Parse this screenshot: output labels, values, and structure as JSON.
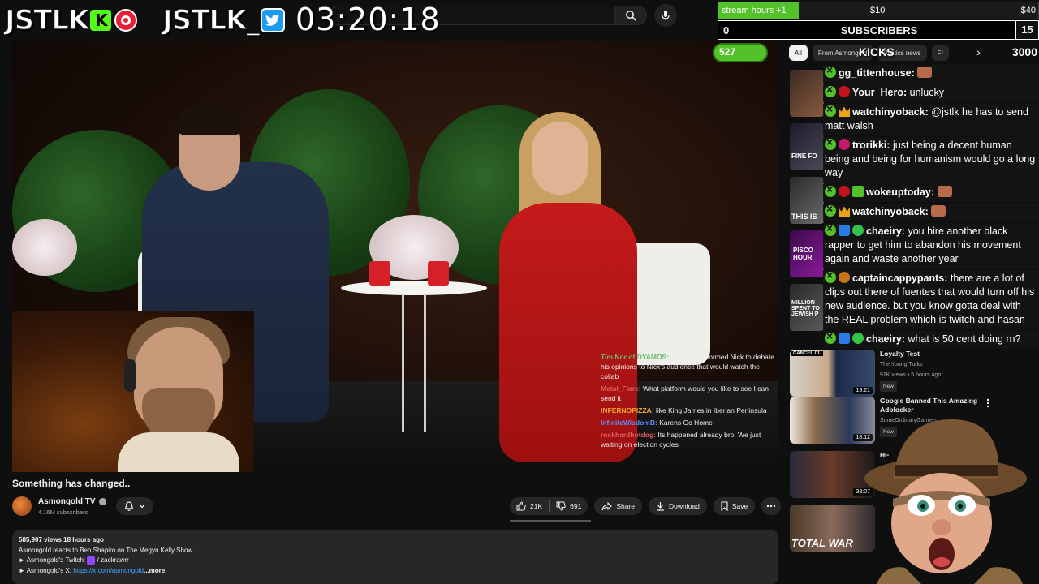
{
  "header": {
    "search_placeholder": "",
    "logo_left_text": "JSTLK",
    "logo_left_badge": "K",
    "logo_right_text": "JSTLK_",
    "clock": "03:20:18"
  },
  "overlay": {
    "stream_hours_label": "stream hours +1",
    "stream_hours_fill": 0.25,
    "stream_mid_amount": "$10",
    "stream_right_amount": "$40",
    "subs_left": "0",
    "subs_label": "SUBSCRIBERS",
    "subs_right": "15",
    "kicks_value": "527",
    "kicks_label": "KICKS",
    "kicks_goal": "3000"
  },
  "chips": [
    "All",
    "From Asmongold",
    "Politics news",
    "Fr"
  ],
  "video": {
    "embedded_chat": [
      {
        "name": "Tim Nor of DYAMOS:",
        "text": "Destiny platformed Nick to debate his opinions to Nick's audience that would watch the collab",
        "color": "n-g"
      },
      {
        "name": "Metal_Flare:",
        "text": "What platform would you like to see I can send it",
        "color": "n-r"
      },
      {
        "name": "INFERNOPIZZA:",
        "text": "like King James in Iberian Peninsula",
        "color": "n-o"
      },
      {
        "name": "InfiniteWisdomB:",
        "text": "Karens Go Home",
        "color": "n-b"
      },
      {
        "name": "rockhardhotdog:",
        "text": "Its happened already bro. We just waiting on election cycles",
        "color": "n-r"
      }
    ],
    "title": "Something has changed.."
  },
  "channel": {
    "name": "Asmongold TV",
    "subscribers": "4.16M subscribers"
  },
  "actions": {
    "likes": "21K",
    "dislikes": "691",
    "share": "Share",
    "download": "Download",
    "save": "Save"
  },
  "description": {
    "meta": "585,907 views  18 hours ago",
    "line1": "Asmongold reacts to Ben Shapiro on The Megyn Kelly Show.",
    "line2_prefix": "► Asmongold's Twitch: ",
    "line2_link": " / zackrawrr",
    "line3_prefix": "► Asmongold's X: ",
    "line3_link": "https://x.com/asmongold",
    "more": "...more"
  },
  "recommendations": [
    {
      "title": "Loyalty Test",
      "channel": "The Young Turks",
      "meta": "91K views • 5 hours ago",
      "badge": "New",
      "duration": "19:21"
    },
    {
      "title": "Google Banned This Amazing Adblocker",
      "channel": "SomeOrdinaryGamers",
      "meta": "",
      "badge": "New",
      "duration": "18:12"
    },
    {
      "title": "HE",
      "channel": "",
      "meta": "",
      "badge": "",
      "duration": "33:07"
    }
  ],
  "side_thumb_text": [
    "FINE FO",
    "THIS IS",
    "PISCO HOUR",
    "MILLION SPENT TO JEWISH P",
    "CANCEL CU",
    "TOTAL WAR"
  ],
  "chat": [
    {
      "icons": [
        "x"
      ],
      "name": "gg_tittenhouse:",
      "text": "",
      "emote": true
    },
    {
      "icons": [
        "x",
        "red"
      ],
      "name": "Your_Hero:",
      "text": "unlucky"
    },
    {
      "icons": [
        "x",
        "crown"
      ],
      "name": "watchinyoback:",
      "text": "@jstlk he has to send matt walsh"
    },
    {
      "icons": [
        "x",
        "mag"
      ],
      "name": "trorikki:",
      "text": "just being a decent human being and being for humanism would go a long way"
    },
    {
      "icons": [
        "x",
        "red",
        "gift"
      ],
      "name": "wokeuptoday:",
      "text": "",
      "emote": true
    },
    {
      "icons": [
        "x",
        "crown"
      ],
      "name": "watchinyoback:",
      "text": "",
      "emote": true
    },
    {
      "icons": [
        "x",
        "blue",
        "green"
      ],
      "name": "chaeiry:",
      "text": "you hire another black rapper to get him to abandon his movement again and waste another year"
    },
    {
      "icons": [
        "x",
        "orange"
      ],
      "name": "captaincappypants:",
      "text": "there are a lot of clips out there of fuentes that would turn off his new audience. but you know gotta deal with the REAL problem which is twitch and hasan"
    },
    {
      "icons": [
        "x",
        "blue",
        "green"
      ],
      "name": "chaeiry:",
      "text": "what is 50 cent doing rn?"
    }
  ],
  "colors": {
    "yt_bg": "#0f0f0f",
    "kick_green": "#53fc18",
    "overlay_green": "#53c22a",
    "link_blue": "#3ea6ff"
  }
}
